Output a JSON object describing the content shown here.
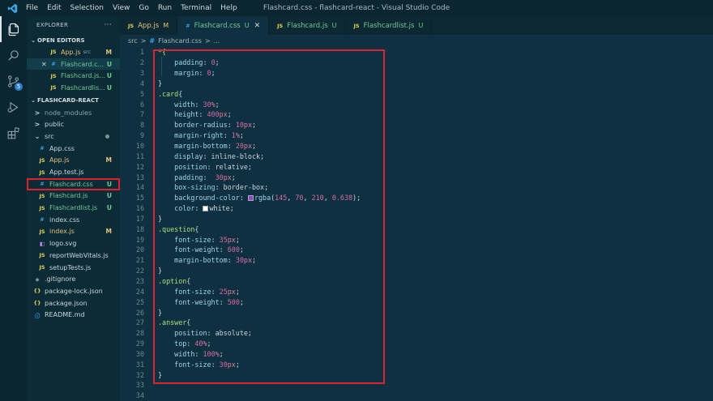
{
  "titlebar": {
    "menu": [
      "File",
      "Edit",
      "Selection",
      "View",
      "Go",
      "Run",
      "Terminal",
      "Help"
    ],
    "title": "Flashcard.css - flashcard-react - Visual Studio Code"
  },
  "activity_icons": [
    "files-icon",
    "search-icon",
    "source-control-icon",
    "run-debug-icon",
    "extensions-icon"
  ],
  "scm_badge": "5",
  "sidebar": {
    "header": "EXPLORER",
    "more": "···",
    "open_editors_title": "OPEN EDITORS",
    "open_editors": [
      {
        "icon": "JS",
        "name": "App.js",
        "suffix": "src",
        "badge": "M",
        "status": "modified",
        "close": false
      },
      {
        "icon": "#",
        "name": "Flashcard.c...",
        "suffix": "",
        "badge": "U",
        "status": "untracked",
        "close": true,
        "selected": true
      },
      {
        "icon": "JS",
        "name": "Flashcard.js...",
        "suffix": "",
        "badge": "U",
        "status": "untracked",
        "close": false
      },
      {
        "icon": "JS",
        "name": "Flashcardlis...",
        "suffix": "",
        "badge": "U",
        "status": "untracked",
        "close": false
      }
    ],
    "project_title": "FLASHCARD-REACT",
    "tree": [
      {
        "indent": 0,
        "type": "folder",
        "chev": ">",
        "name": "node_modules",
        "badge": "",
        "status": "dim"
      },
      {
        "indent": 0,
        "type": "folder",
        "chev": ">",
        "name": "public",
        "badge": "",
        "status": "plain"
      },
      {
        "indent": 0,
        "type": "folder",
        "chev": "⌄",
        "name": "src",
        "badge": "",
        "status": "plain",
        "dot": true
      },
      {
        "indent": 1,
        "type": "css",
        "icon": "#",
        "name": "App.css",
        "badge": "",
        "status": "plain"
      },
      {
        "indent": 1,
        "type": "js",
        "icon": "JS",
        "name": "App.js",
        "badge": "M",
        "status": "modified"
      },
      {
        "indent": 1,
        "type": "js",
        "icon": "JS",
        "name": "App.test.js",
        "badge": "",
        "status": "plain"
      },
      {
        "indent": 1,
        "type": "css",
        "icon": "#",
        "name": "Flashcard.css",
        "badge": "U",
        "status": "untracked",
        "boxed": true
      },
      {
        "indent": 1,
        "type": "js",
        "icon": "JS",
        "name": "Flashcard.js",
        "badge": "U",
        "status": "untracked"
      },
      {
        "indent": 1,
        "type": "js",
        "icon": "JS",
        "name": "Flashcardlist.js",
        "badge": "U",
        "status": "untracked"
      },
      {
        "indent": 1,
        "type": "css",
        "icon": "#",
        "name": "index.css",
        "badge": "",
        "status": "plain"
      },
      {
        "indent": 1,
        "type": "js",
        "icon": "JS",
        "name": "index.js",
        "badge": "M",
        "status": "modified"
      },
      {
        "indent": 1,
        "type": "svg",
        "icon": "◧",
        "name": "logo.svg",
        "badge": "",
        "status": "plain"
      },
      {
        "indent": 1,
        "type": "js",
        "icon": "JS",
        "name": "reportWebVitals.js",
        "badge": "",
        "status": "plain"
      },
      {
        "indent": 1,
        "type": "js",
        "icon": "JS",
        "name": "setupTests.js",
        "badge": "",
        "status": "plain"
      },
      {
        "indent": 0,
        "type": "git",
        "icon": "◆",
        "name": ".gitignore",
        "badge": "",
        "status": "plain"
      },
      {
        "indent": 0,
        "type": "json",
        "icon": "{}",
        "name": "package-lock.json",
        "badge": "",
        "status": "plain"
      },
      {
        "indent": 0,
        "type": "json",
        "icon": "{}",
        "name": "package.json",
        "badge": "",
        "status": "plain"
      },
      {
        "indent": 0,
        "type": "info",
        "icon": "ⓘ",
        "name": "README.md",
        "badge": "",
        "status": "plain"
      }
    ]
  },
  "tabs": [
    {
      "icon": "JS",
      "name": "App.js",
      "badge": "M",
      "active": false,
      "status": "modified"
    },
    {
      "icon": "#",
      "name": "Flashcard.css",
      "badge": "U",
      "active": true,
      "status": "untracked",
      "close": "✕"
    },
    {
      "icon": "JS",
      "name": "Flashcard.js",
      "badge": "U",
      "active": false,
      "status": "untracked"
    },
    {
      "icon": "JS",
      "name": "Flashcardlist.js",
      "badge": "U",
      "active": false,
      "status": "untracked"
    }
  ],
  "breadcrumb": [
    "src",
    ">",
    "#",
    "Flashcard.css",
    ">",
    "..."
  ],
  "code": [
    [
      [
        "sel",
        "*{"
      ]
    ],
    [
      [
        "prop",
        "    padding"
      ],
      [
        "kw",
        ": "
      ],
      [
        "num",
        "0"
      ],
      [
        "kw",
        ";"
      ]
    ],
    [
      [
        "prop",
        "    margin"
      ],
      [
        "kw",
        ": "
      ],
      [
        "num",
        "0"
      ],
      [
        "kw",
        ";"
      ]
    ],
    [
      [
        "kw",
        "}"
      ]
    ],
    [
      [
        "sel",
        ".card"
      ],
      [
        "kw",
        "{"
      ]
    ],
    [
      [
        "prop",
        "    width"
      ],
      [
        "kw",
        ": "
      ],
      [
        "num",
        "30"
      ],
      [
        "unit",
        "%"
      ],
      [
        "kw",
        ";"
      ]
    ],
    [
      [
        "prop",
        "    height"
      ],
      [
        "kw",
        ": "
      ],
      [
        "num",
        "400"
      ],
      [
        "unit",
        "px"
      ],
      [
        "kw",
        ";"
      ]
    ],
    [
      [
        "prop",
        "    border-radius"
      ],
      [
        "kw",
        ": "
      ],
      [
        "num",
        "10"
      ],
      [
        "unit",
        "px"
      ],
      [
        "kw",
        ";"
      ]
    ],
    [
      [
        "prop",
        "    margin-right"
      ],
      [
        "kw",
        ": "
      ],
      [
        "num",
        "1"
      ],
      [
        "unit",
        "%"
      ],
      [
        "kw",
        ";"
      ]
    ],
    [
      [
        "prop",
        "    margin-bottom"
      ],
      [
        "kw",
        ": "
      ],
      [
        "num",
        "20"
      ],
      [
        "unit",
        "px"
      ],
      [
        "kw",
        ";"
      ]
    ],
    [
      [
        "prop",
        "    display"
      ],
      [
        "kw",
        ": inline-block;"
      ]
    ],
    [
      [
        "prop",
        "    position"
      ],
      [
        "kw",
        ": relative;"
      ]
    ],
    [
      [
        "prop",
        "    padding"
      ],
      [
        "kw",
        ":  "
      ],
      [
        "num",
        "30"
      ],
      [
        "unit",
        "px"
      ],
      [
        "kw",
        ";"
      ]
    ],
    [
      [
        "prop",
        "    box-sizing"
      ],
      [
        "kw",
        ": border-box;"
      ]
    ],
    [
      [
        "prop",
        "    background-color"
      ],
      [
        "kw",
        ": "
      ],
      [
        "swatch",
        "#9146d2"
      ],
      [
        "prop",
        "rgba"
      ],
      [
        "kw",
        "("
      ],
      [
        "num",
        "145"
      ],
      [
        "kw",
        ", "
      ],
      [
        "num",
        "70"
      ],
      [
        "kw",
        ", "
      ],
      [
        "num",
        "210"
      ],
      [
        "kw",
        ", "
      ],
      [
        "num",
        "0.638"
      ],
      [
        "kw",
        ");"
      ]
    ],
    [
      [
        "prop",
        "    color"
      ],
      [
        "kw",
        ": "
      ],
      [
        "swatch",
        "#ffffff"
      ],
      [
        "kw",
        "white;"
      ]
    ],
    [
      [
        "kw",
        "}"
      ]
    ],
    [
      [
        "sel",
        ".question"
      ],
      [
        "kw",
        "{"
      ]
    ],
    [
      [
        "prop",
        "    font-size"
      ],
      [
        "kw",
        ": "
      ],
      [
        "num",
        "35"
      ],
      [
        "unit",
        "px"
      ],
      [
        "kw",
        ";"
      ]
    ],
    [
      [
        "prop",
        "    font-weight"
      ],
      [
        "kw",
        ": "
      ],
      [
        "num",
        "600"
      ],
      [
        "kw",
        ";"
      ]
    ],
    [
      [
        "prop",
        "    margin-bottom"
      ],
      [
        "kw",
        ": "
      ],
      [
        "num",
        "30"
      ],
      [
        "unit",
        "px"
      ],
      [
        "kw",
        ";"
      ]
    ],
    [
      [
        "kw",
        "}"
      ]
    ],
    [
      [
        "sel",
        ".option"
      ],
      [
        "kw",
        "{"
      ]
    ],
    [
      [
        "prop",
        "    font-size"
      ],
      [
        "kw",
        ": "
      ],
      [
        "num",
        "25"
      ],
      [
        "unit",
        "px"
      ],
      [
        "kw",
        ";"
      ]
    ],
    [
      [
        "prop",
        "    font-weight"
      ],
      [
        "kw",
        ": "
      ],
      [
        "num",
        "500"
      ],
      [
        "kw",
        ";"
      ]
    ],
    [
      [
        "kw",
        "}"
      ]
    ],
    [
      [
        "sel",
        ".answer"
      ],
      [
        "kw",
        "{"
      ]
    ],
    [
      [
        "prop",
        "    position"
      ],
      [
        "kw",
        ": absolute;"
      ]
    ],
    [
      [
        "prop",
        "    top"
      ],
      [
        "kw",
        ": "
      ],
      [
        "num",
        "40"
      ],
      [
        "unit",
        "%"
      ],
      [
        "kw",
        ";"
      ]
    ],
    [
      [
        "prop",
        "    width"
      ],
      [
        "kw",
        ": "
      ],
      [
        "num",
        "100"
      ],
      [
        "unit",
        "%"
      ],
      [
        "kw",
        ";"
      ]
    ],
    [
      [
        "prop",
        "    font-size"
      ],
      [
        "kw",
        ": "
      ],
      [
        "num",
        "30"
      ],
      [
        "unit",
        "px"
      ],
      [
        "kw",
        ";"
      ]
    ],
    [
      [
        "kw",
        "}"
      ]
    ],
    [],
    []
  ],
  "colors": {
    "accent_red": "#d9232e",
    "modified": "#e5c07b",
    "untracked": "#73c991",
    "js_icon": "#e6d35a",
    "css_icon": "#3fa0e6"
  }
}
